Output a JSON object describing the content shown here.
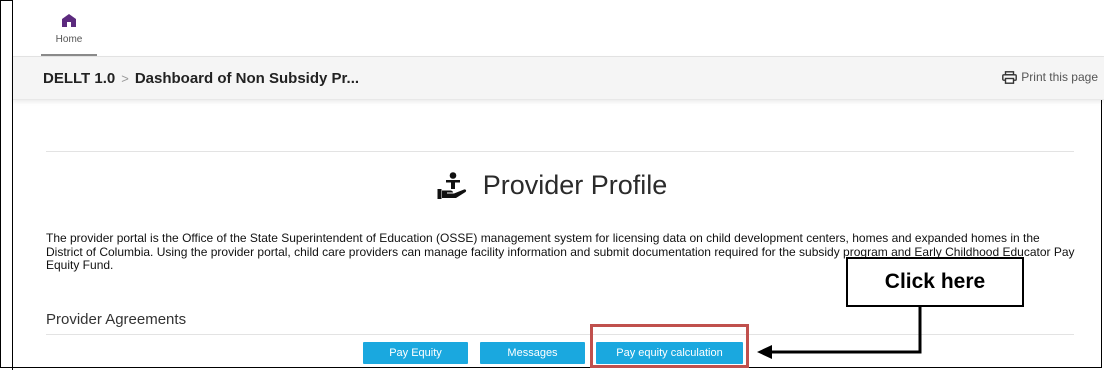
{
  "nav": {
    "home_label": "Home"
  },
  "breadcrumb": {
    "root": "DELLT 1.0",
    "separator": ">",
    "current": "Dashboard of Non Subsidy Pr..."
  },
  "print": {
    "label": "Print this page"
  },
  "profile": {
    "title": "Provider Profile",
    "description": "The provider portal is the Office of the State Superintendent of Education (OSSE) management system for licensing data on child development centers, homes and expanded homes in the District of Columbia. Using the provider portal, child care providers can manage facility information and submit documentation required for the subsidy program and Early Childhood Educator Pay Equity Fund."
  },
  "agreements": {
    "heading": "Provider Agreements",
    "buttons": [
      {
        "label": "Pay Equity"
      },
      {
        "label": "Messages"
      },
      {
        "label": "Pay equity calculation"
      }
    ]
  },
  "callout": {
    "label": "Click here"
  },
  "colors": {
    "button": "#1aa8df",
    "highlight": "#c0504d",
    "home_icon": "#5c2a7e"
  }
}
